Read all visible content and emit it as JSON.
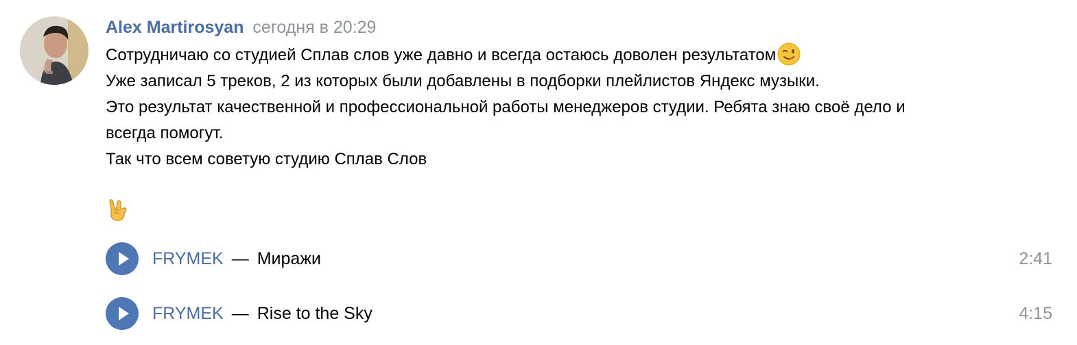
{
  "post": {
    "author": "Alex Martirosyan",
    "timestamp": "сегодня в 20:29",
    "lines": [
      "Сотрудничаю со студией Сплав слов уже давно и всегда остаюсь доволен результатом",
      "Уже записал 5 треков, 2 из которых были добавлены в подборки плейлистов Яндекс музыки.",
      "Это результат качественной и профессиональной работы менеджеров студии. Ребята знаю своё дело и",
      "всегда помогут.",
      "Так что всем советую студию Сплав Слов"
    ],
    "emoji_after_line1": "winking-face-emoji",
    "standalone_emoji": "sign-of-the-horns-emoji"
  },
  "audio": [
    {
      "artist": "FRYMEK",
      "separator": "—",
      "title": "Миражи",
      "duration": "2:41"
    },
    {
      "artist": "FRYMEK",
      "separator": "—",
      "title": "Rise to the Sky",
      "duration": "4:15"
    }
  ],
  "colors": {
    "author": "#4a6ea0",
    "meta": "#8d9399",
    "play_button": "#4d78b5"
  }
}
